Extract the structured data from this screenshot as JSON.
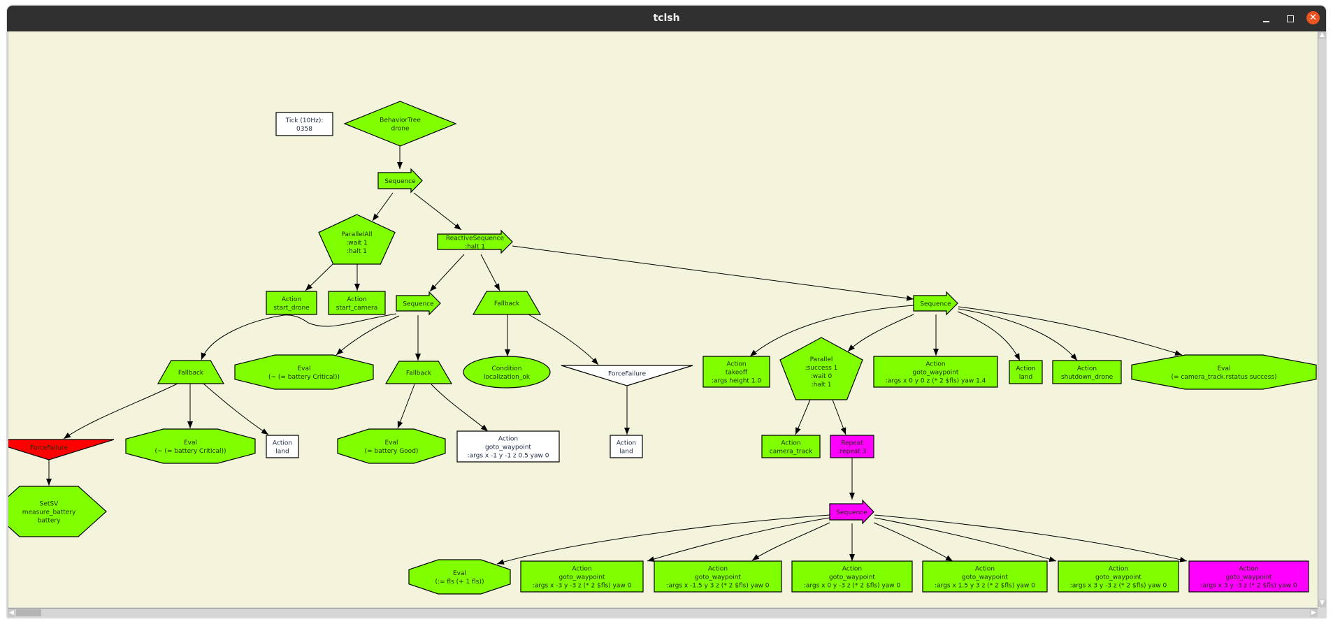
{
  "window": {
    "title": "tclsh"
  },
  "colors": {
    "success_green": "#7fff00",
    "running_magenta": "#ff00ff",
    "failure_red": "#ff0000",
    "idle_white": "#ffffff",
    "canvas_bg": "#f4f4dc"
  },
  "nodes": [
    {
      "shape": "rect",
      "color": "#ffffff",
      "lines": [
        "Tick (10Hz):",
        "0358"
      ]
    },
    {
      "shape": "diamond",
      "color": "#7fff00",
      "lines": [
        "BehaviorTree",
        "drone"
      ]
    },
    {
      "shape": "arrow",
      "color": "#7fff00",
      "lines": [
        "Sequence"
      ]
    },
    {
      "shape": "pentagon",
      "color": "#7fff00",
      "lines": [
        "ParallelAll",
        ":wait 1",
        ":halt 1"
      ]
    },
    {
      "shape": "arrow",
      "color": "#7fff00",
      "lines": [
        "ReactiveSequence",
        ":halt 1"
      ]
    },
    {
      "shape": "rect",
      "color": "#7fff00",
      "lines": [
        "Action",
        "start_drone"
      ]
    },
    {
      "shape": "rect",
      "color": "#7fff00",
      "lines": [
        "Action",
        "start_camera"
      ]
    },
    {
      "shape": "arrow",
      "color": "#7fff00",
      "lines": [
        "Sequence"
      ]
    },
    {
      "shape": "trapezoid",
      "color": "#7fff00",
      "lines": [
        "Fallback"
      ]
    },
    {
      "shape": "trapezoid",
      "color": "#7fff00",
      "lines": [
        "Fallback"
      ]
    },
    {
      "shape": "octagon",
      "color": "#7fff00",
      "lines": [
        "Eval",
        "(~ (= battery Critical))"
      ]
    },
    {
      "shape": "trapezoid",
      "color": "#7fff00",
      "lines": [
        "Fallback"
      ]
    },
    {
      "shape": "ellipse",
      "color": "#7fff00",
      "lines": [
        "Condition",
        "localization_ok"
      ]
    },
    {
      "shape": "triangle",
      "color": "#ffffff",
      "lines": [
        "ForceFailure"
      ]
    },
    {
      "shape": "triangle",
      "color": "#ff0000",
      "lines": [
        "ForceFailure"
      ]
    },
    {
      "shape": "octagon",
      "color": "#7fff00",
      "lines": [
        "Eval",
        "(~ (= battery Critical))"
      ]
    },
    {
      "shape": "rect",
      "color": "#ffffff",
      "lines": [
        "Action",
        "land"
      ]
    },
    {
      "shape": "octagon",
      "color": "#7fff00",
      "lines": [
        "Eval",
        "(= battery Good)"
      ]
    },
    {
      "shape": "rect",
      "color": "#ffffff",
      "lines": [
        "Action",
        "goto_waypoint",
        ":args x -1 y -1 z 0.5 yaw 0"
      ]
    },
    {
      "shape": "rect",
      "color": "#ffffff",
      "lines": [
        "Action",
        "land"
      ]
    },
    {
      "shape": "hexagon",
      "color": "#7fff00",
      "lines": [
        "SetSV",
        "measure_battery",
        "battery"
      ]
    },
    {
      "shape": "arrow",
      "color": "#7fff00",
      "lines": [
        "Sequence"
      ]
    },
    {
      "shape": "rect",
      "color": "#7fff00",
      "lines": [
        "Action",
        "takeoff",
        ":args height 1.0"
      ]
    },
    {
      "shape": "pentagon",
      "color": "#7fff00",
      "lines": [
        "Parallel",
        ":success 1",
        ":wait 0",
        ":halt 1"
      ]
    },
    {
      "shape": "rect",
      "color": "#7fff00",
      "lines": [
        "Action",
        "goto_waypoint",
        ":args x 0 y 0 z (* 2 $fls) yaw 1.4"
      ]
    },
    {
      "shape": "rect",
      "color": "#7fff00",
      "lines": [
        "Action",
        "land"
      ]
    },
    {
      "shape": "rect",
      "color": "#7fff00",
      "lines": [
        "Action",
        "shutdown_drone"
      ]
    },
    {
      "shape": "octagon",
      "color": "#7fff00",
      "lines": [
        "Eval",
        "(= camera_track.rstatus success)"
      ]
    },
    {
      "shape": "rect",
      "color": "#7fff00",
      "lines": [
        "Action",
        "camera_track"
      ]
    },
    {
      "shape": "rect",
      "color": "#ff00ff",
      "lines": [
        "Repeat",
        ":repeat 3"
      ]
    },
    {
      "shape": "arrow",
      "color": "#ff00ff",
      "lines": [
        "Sequence"
      ]
    },
    {
      "shape": "octagon",
      "color": "#7fff00",
      "lines": [
        "Eval",
        "(:= fls (+ 1 fls))"
      ]
    },
    {
      "shape": "rect",
      "color": "#7fff00",
      "lines": [
        "Action",
        "goto_waypoint",
        ":args x -3 y -3 z (* 2 $fls) yaw 0"
      ]
    },
    {
      "shape": "rect",
      "color": "#7fff00",
      "lines": [
        "Action",
        "goto_waypoint",
        ":args x -1.5 y 3 z (* 2 $fls) yaw 0"
      ]
    },
    {
      "shape": "rect",
      "color": "#7fff00",
      "lines": [
        "Action",
        "goto_waypoint",
        ":args x 0 y -3 z (* 2 $fls) yaw 0"
      ]
    },
    {
      "shape": "rect",
      "color": "#7fff00",
      "lines": [
        "Action",
        "goto_waypoint",
        ":args x 1.5 y 3 z (* 2 $fls) yaw 0"
      ]
    },
    {
      "shape": "rect",
      "color": "#7fff00",
      "lines": [
        "Action",
        "goto_waypoint",
        ":args x 3 y -3 z (* 2 $fls) yaw 0"
      ]
    },
    {
      "shape": "rect",
      "color": "#ff00ff",
      "lines": [
        "Action",
        "goto_waypoint",
        ":args x 3 y -3 z (* 2 $fls) yaw 0"
      ]
    }
  ]
}
